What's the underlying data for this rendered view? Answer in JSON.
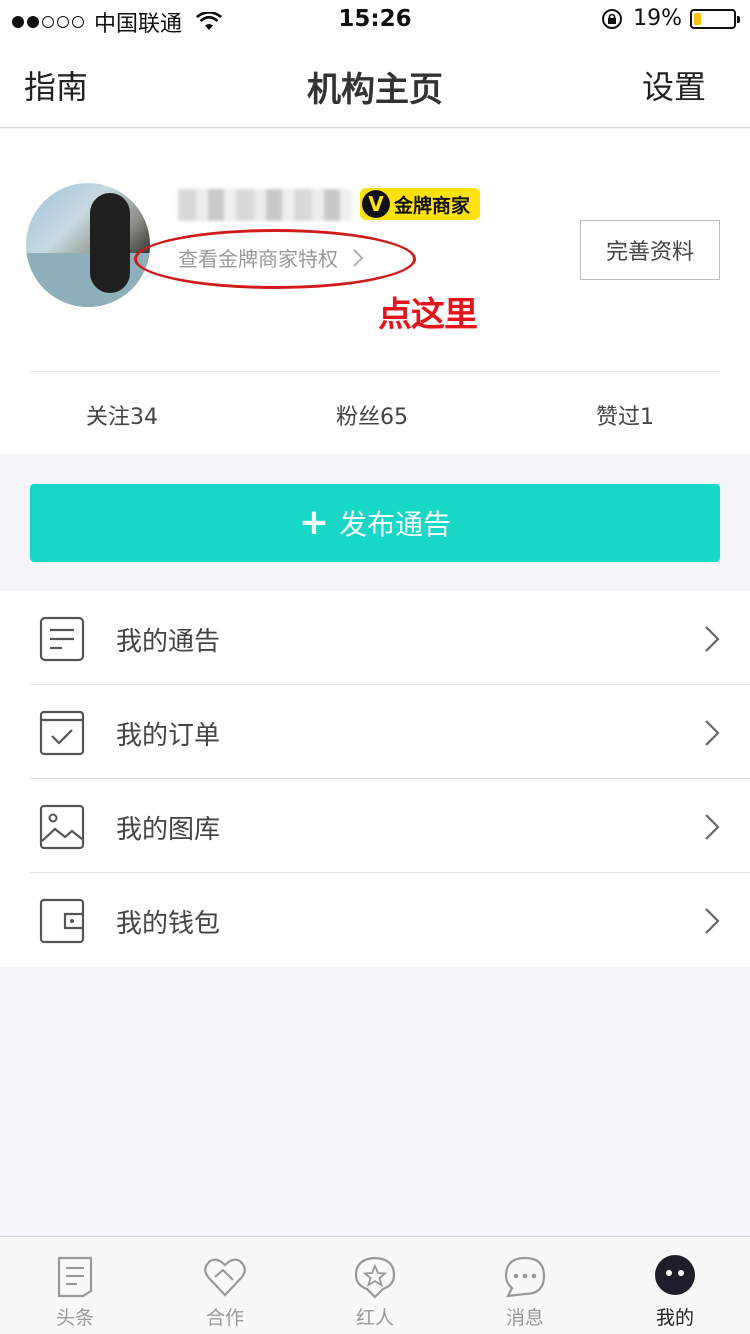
{
  "status_bar": {
    "carrier": "中国联通",
    "time": "15:26",
    "battery_percent_text": "19%",
    "battery_level": 0.19,
    "signal_bars": 2
  },
  "nav": {
    "left": "指南",
    "title": "机构主页",
    "right": "设置"
  },
  "profile": {
    "badge_text": "金牌商家",
    "badge_icon": "V",
    "privilege_link": "查看金牌商家特权",
    "annotation": "点这里",
    "edit_button": "完善资料",
    "stats": {
      "following": "关注34",
      "fans": "粉丝65",
      "likes": "赞过1"
    }
  },
  "publish_button": {
    "plus": "+",
    "label": "发布通告"
  },
  "menu": [
    {
      "label": "我的通告",
      "icon": "document-icon"
    },
    {
      "label": "我的订单",
      "icon": "order-check-icon"
    },
    {
      "label": "我的图库",
      "icon": "image-gallery-icon"
    },
    {
      "label": "我的钱包",
      "icon": "wallet-icon"
    }
  ],
  "tab_bar": [
    {
      "label": "头条",
      "icon": "news-icon"
    },
    {
      "label": "合作",
      "icon": "handshake-heart-icon"
    },
    {
      "label": "红人",
      "icon": "star-badge-icon"
    },
    {
      "label": "消息",
      "icon": "chat-bubble-icon"
    },
    {
      "label": "我的",
      "icon": "profile-avatar-icon",
      "active": true
    }
  ],
  "colors": {
    "accent": "#17d7c6",
    "badge": "#ffe10e",
    "annotation": "#e5141b",
    "battery": "#f7c510"
  }
}
